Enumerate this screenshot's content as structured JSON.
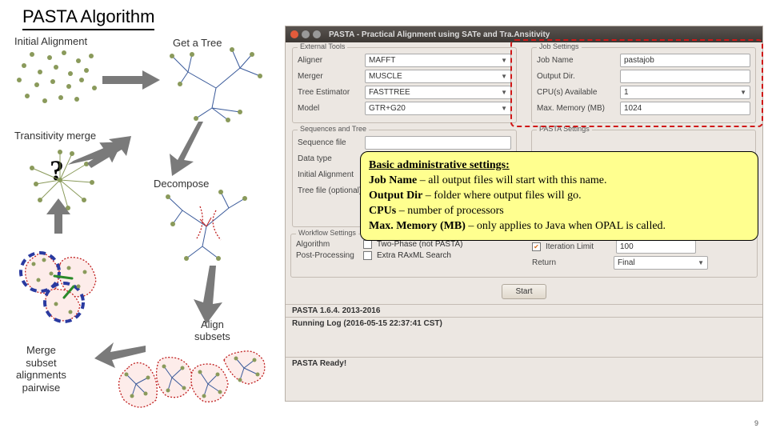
{
  "title": "PASTA Algorithm",
  "pagenum": "9",
  "labels": {
    "initial": "Initial Alignment",
    "getTree": "Get a Tree",
    "transitivity": "Transitivity merge",
    "decompose": "Decompose",
    "alignSubsets": "Align\nsubsets",
    "mergeSubset": "Merge\nsubset\nalignments\npairwise",
    "question": "?"
  },
  "app": {
    "windowTitle": "PASTA - Practical Alignment using SATe and Tra.Ansitivity",
    "externalTools": {
      "frame": "External Tools",
      "aligner": "Aligner",
      "alignerVal": "MAFFT",
      "merger": "Merger",
      "mergerVal": "MUSCLE",
      "treeEst": "Tree Estimator",
      "treeEstVal": "FASTTREE",
      "model": "Model",
      "modelVal": "GTR+G20"
    },
    "jobSettings": {
      "frame": "Job Settings",
      "jobName": "Job Name",
      "jobNameVal": "pastajob",
      "outputDir": "Output Dir.",
      "outputDirVal": "",
      "cpus": "CPU(s) Available",
      "cpusVal": "1",
      "maxMem": "Max. Memory (MB)",
      "maxMemVal": "1024"
    },
    "seqTree": {
      "frame": "Sequences and Tree",
      "seqFile": "Sequence file",
      "dataType": "Data type",
      "initAlign": "Initial Alignment",
      "treeFile": "Tree file (optional)"
    },
    "pastaSettings": {
      "frame": "PASTA Settings"
    },
    "workflow": {
      "frame": "Workflow Settings",
      "algorithm": "Algorithm",
      "twoPhase": "Two-Phase (not PASTA)",
      "postProc": "Post-Processing",
      "raxml": "Extra RAxML Search",
      "iterLimit": "Iteration Limit",
      "iterLimitVal": "100",
      "return": "Return",
      "returnVal": "Final"
    },
    "start": "Start",
    "footer": {
      "version": "PASTA 1.6.4. 2013-2016",
      "runlog": "Running Log (2016-05-15 22:37:41 CST)",
      "ready": "PASTA Ready!"
    }
  },
  "callout": {
    "title": "Basic administrative settings:",
    "l1a": "Job Name",
    "l1b": " – all output files will start with this name.",
    "l2a": "Output Dir",
    "l2b": " – folder where output files will go.",
    "l3a": "CPUs",
    "l3b": " – number of processors",
    "l4a": "Max. Memory (MB)",
    "l4b": " – only applies to Java when OPAL is called."
  }
}
